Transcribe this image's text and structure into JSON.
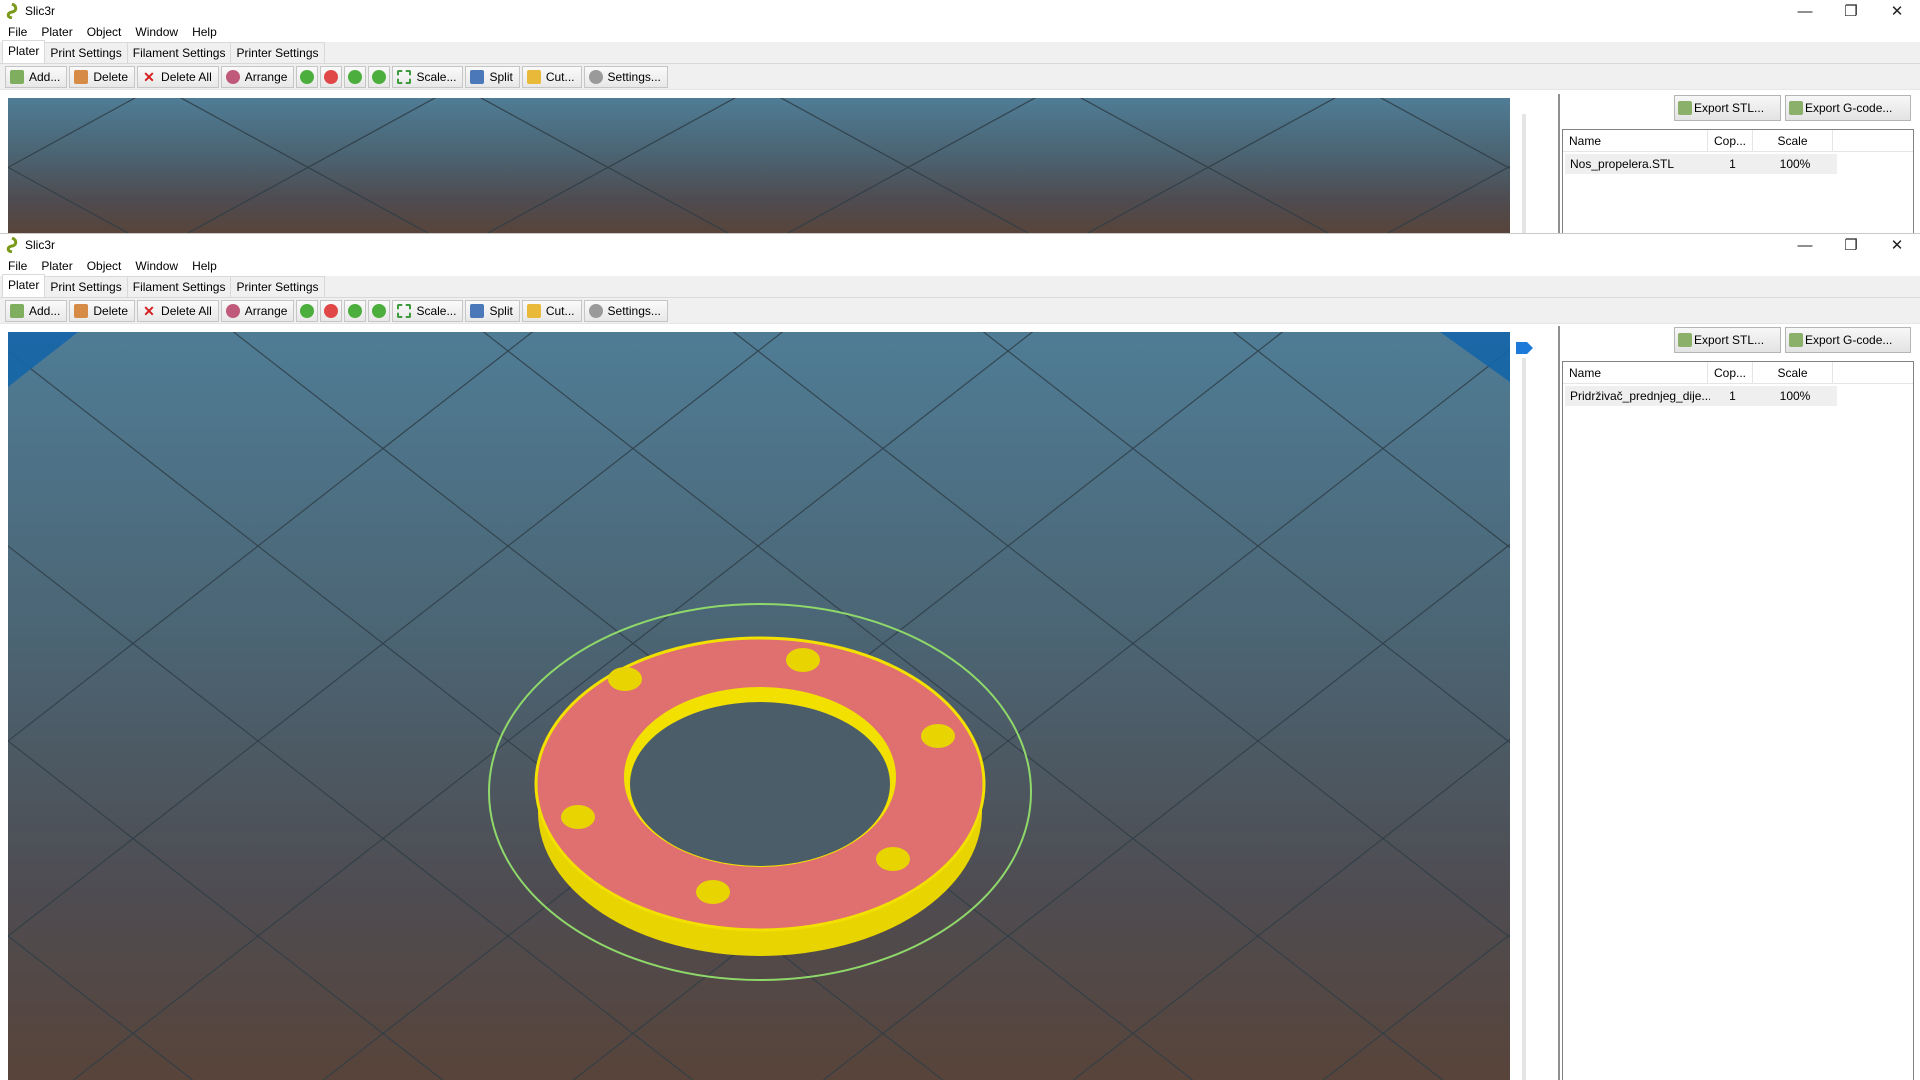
{
  "window1": {
    "title": "Slic3r",
    "menu": [
      "File",
      "Plater",
      "Object",
      "Window",
      "Help"
    ],
    "tabs": [
      "Plater",
      "Print Settings",
      "Filament Settings",
      "Printer Settings"
    ],
    "toolbar": {
      "add": "Add...",
      "delete": "Delete",
      "delete_all": "Delete All",
      "arrange": "Arrange",
      "scale": "Scale...",
      "split": "Split",
      "cut": "Cut...",
      "settings": "Settings..."
    },
    "export_stl": "Export STL...",
    "export_gcode": "Export G-code...",
    "object_list": {
      "columns": [
        "Name",
        "Cop...",
        "Scale"
      ],
      "rows": [
        {
          "name": "Nos_propelera.STL",
          "copies": "1",
          "scale": "100%"
        }
      ]
    }
  },
  "window2": {
    "title": "Slic3r",
    "menu": [
      "File",
      "Plater",
      "Object",
      "Window",
      "Help"
    ],
    "tabs": [
      "Plater",
      "Print Settings",
      "Filament Settings",
      "Printer Settings"
    ],
    "toolbar": {
      "add": "Add...",
      "delete": "Delete",
      "delete_all": "Delete All",
      "arrange": "Arrange",
      "scale": "Scale...",
      "split": "Split",
      "cut": "Cut...",
      "settings": "Settings..."
    },
    "export_stl": "Export STL...",
    "export_gcode": "Export G-code...",
    "object_list": {
      "columns": [
        "Name",
        "Cop...",
        "Scale"
      ],
      "rows": [
        {
          "name": "Pridrživač_prednjeg_dije...",
          "copies": "1",
          "scale": "100%"
        }
      ]
    }
  },
  "colors": {
    "bed_top": "#4f7c95",
    "bed_bottom": "#58443a",
    "object_top": "#e07070",
    "object_side": "#f2e000",
    "selection_ring": "#8fd86a",
    "corner_marker": "#1565a8"
  },
  "window_controls": [
    "minimize-icon",
    "restore-icon",
    "close-icon"
  ]
}
